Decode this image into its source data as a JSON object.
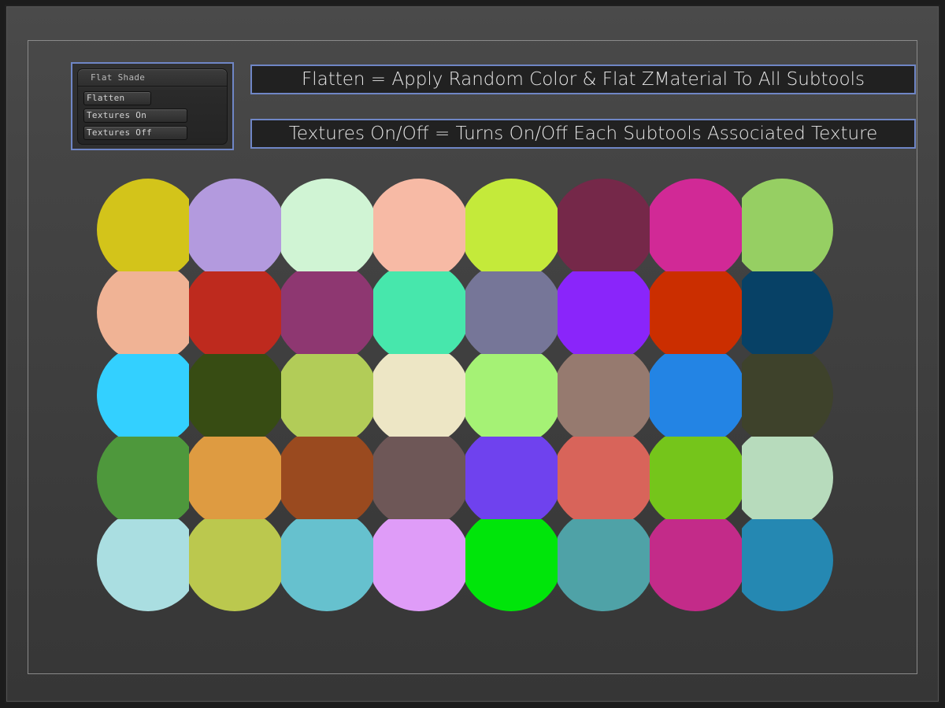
{
  "panel": {
    "title": "Flat Shade",
    "buttons": [
      "Flatten",
      "Textures On",
      "Textures Off"
    ]
  },
  "callouts": {
    "flatten": "Flatten = Apply Random Color & Flat ZMaterial To All Subtools",
    "textures": "Textures On/Off = Turns On/Off Each Subtools Associated Texture"
  },
  "swatch_grid": {
    "rows": 5,
    "cols": 8,
    "colors": [
      [
        "#d3c41a",
        "#b39ade",
        "#d0f4d4",
        "#f7baa5",
        "#c4ea3a",
        "#752849",
        "#d12996",
        "#96cf63"
      ],
      [
        "#f0b395",
        "#be2a1e",
        "#8e3771",
        "#47e7ac",
        "#767698",
        "#8a25fa",
        "#cb2e00",
        "#074166"
      ],
      [
        "#33d0ff",
        "#374c13",
        "#b2cc58",
        "#ede6c5",
        "#a5f275",
        "#967a6f",
        "#2384e4",
        "#3e422b"
      ],
      [
        "#4e983c",
        "#de9b41",
        "#9a4a1f",
        "#6e5757",
        "#6f42ee",
        "#d8645a",
        "#75c51b",
        "#b7dbbc"
      ],
      [
        "#aadee1",
        "#bbc84e",
        "#66c1ce",
        "#df9cf8",
        "#00e50a",
        "#4fa2a7",
        "#c32b89",
        "#2588b2"
      ]
    ]
  }
}
